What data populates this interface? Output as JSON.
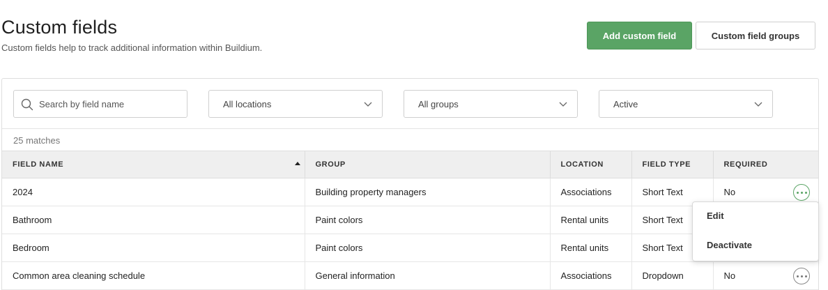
{
  "header": {
    "title": "Custom fields",
    "subtitle": "Custom fields help to track additional information within Buildium.",
    "add_button": "Add custom field",
    "groups_button": "Custom field groups"
  },
  "filters": {
    "search_placeholder": "Search by field name",
    "location": "All locations",
    "group": "All groups",
    "status": "Active"
  },
  "results": {
    "count_text": "25 matches"
  },
  "table": {
    "columns": [
      "FIELD NAME",
      "GROUP",
      "LOCATION",
      "FIELD TYPE",
      "REQUIRED"
    ],
    "sorted_column": "FIELD NAME",
    "sort_direction": "ascending",
    "rows": [
      {
        "name": "2024",
        "group": "Building property managers",
        "location": "Associations",
        "type": "Short Text",
        "required": "No"
      },
      {
        "name": "Bathroom",
        "group": "Paint colors",
        "location": "Rental units",
        "type": "Short Text",
        "required": ""
      },
      {
        "name": "Bedroom",
        "group": "Paint colors",
        "location": "Rental units",
        "type": "Short Text",
        "required": ""
      },
      {
        "name": "Common area cleaning schedule",
        "group": "General information",
        "location": "Associations",
        "type": "Dropdown",
        "required": "No"
      }
    ]
  },
  "row_menu": {
    "edit": "Edit",
    "deactivate": "Deactivate"
  },
  "colors": {
    "accent": "#5aa465",
    "header_bg": "#efefef",
    "border": "#dedede"
  },
  "icons": {
    "search": "search-icon",
    "dropdown": "chevron-down-icon",
    "more": "more-options-icon"
  }
}
